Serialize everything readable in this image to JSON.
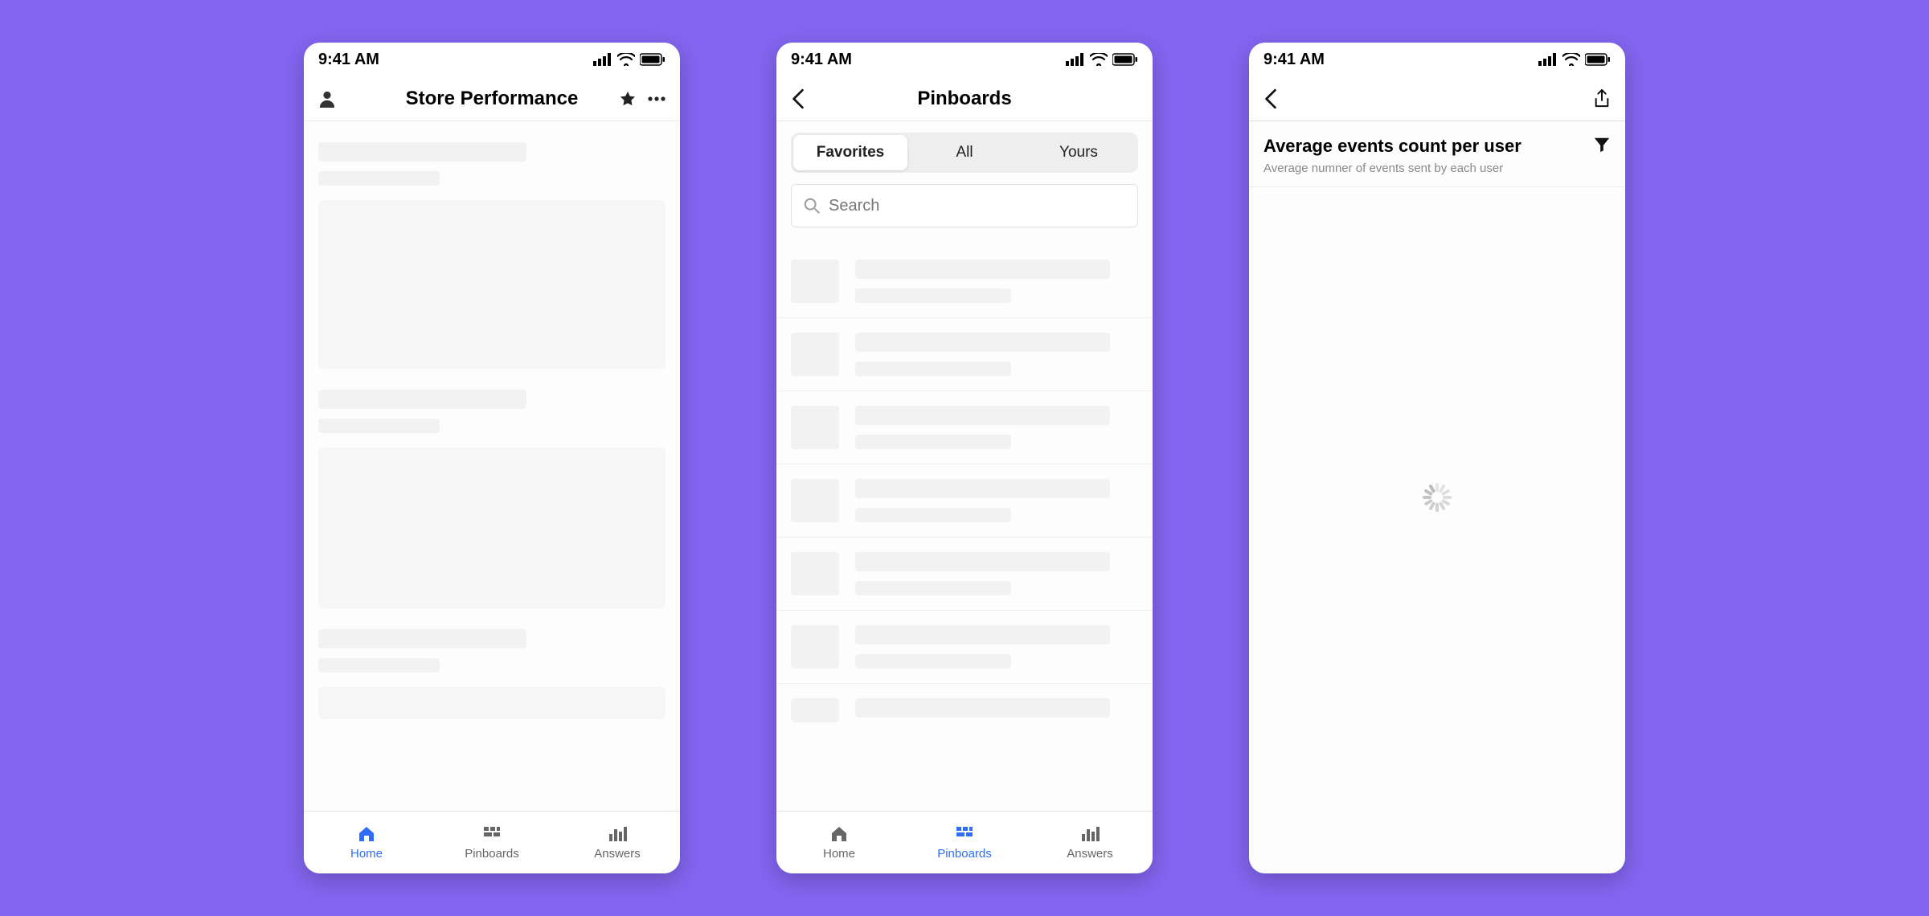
{
  "status": {
    "time": "9:41 AM"
  },
  "colors": {
    "accent": "#2f6df6",
    "bg": "#8466f2"
  },
  "screen1": {
    "title": "Store Performance",
    "tabs": {
      "home": "Home",
      "pinboards": "Pinboards",
      "answers": "Answers"
    }
  },
  "screen2": {
    "title": "Pinboards",
    "segments": {
      "favorites": "Favorites",
      "all": "All",
      "yours": "Yours"
    },
    "search_placeholder": "Search",
    "tabs": {
      "home": "Home",
      "pinboards": "Pinboards",
      "answers": "Answers"
    }
  },
  "screen3": {
    "title": "",
    "answer_title": "Average events count per user",
    "answer_subtitle": "Average numner of events sent by each user"
  }
}
